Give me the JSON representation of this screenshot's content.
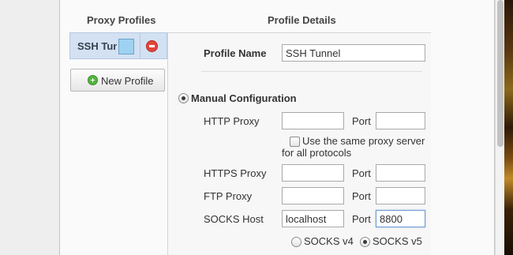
{
  "left_column": {
    "title": "Proxy Profiles",
    "profiles": [
      {
        "name": "SSH Tunnel",
        "color": "#9fd2f2"
      }
    ],
    "new_profile_label": "New Profile"
  },
  "right_column": {
    "title": "Profile Details",
    "profile_name_label": "Profile Name",
    "profile_name_value": "SSH Tunnel",
    "manual_config_label": "Manual Configuration",
    "manual_config_selected": true,
    "http_proxy": {
      "label": "HTTP Proxy",
      "host": "",
      "port_label": "Port",
      "port": ""
    },
    "same_proxy_line1": "Use the same proxy server",
    "same_proxy_line2": "for all protocols",
    "same_proxy_checked": false,
    "https_proxy": {
      "label": "HTTPS Proxy",
      "host": "",
      "port_label": "Port",
      "port": ""
    },
    "ftp_proxy": {
      "label": "FTP Proxy",
      "host": "",
      "port_label": "Port",
      "port": ""
    },
    "socks": {
      "label": "SOCKS Host",
      "host": "localhost",
      "port_label": "Port",
      "port": "8800"
    },
    "socks_versions": [
      {
        "label": "SOCKS v4",
        "selected": false
      },
      {
        "label": "SOCKS v5",
        "selected": true
      }
    ]
  },
  "colors": {
    "profile_row_bg": "#d3e1f2",
    "delete_red": "#e3453b",
    "add_green": "#53b43f",
    "focus_border": "#6d9bd1"
  }
}
